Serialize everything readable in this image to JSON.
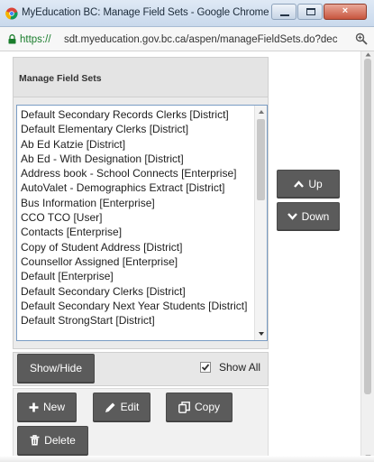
{
  "window": {
    "title": "MyEducation BC: Manage Field Sets - Google Chrome",
    "minimize_label": "",
    "maximize_label": "",
    "close_label": "×"
  },
  "address_bar": {
    "scheme": "https://",
    "url_rest": "sdt.myeducation.gov.bc.ca/aspen/manageFieldSets.do?dec"
  },
  "panel": {
    "title": "Manage Field Sets"
  },
  "field_sets": [
    "Default Secondary Records Clerks [District]",
    "Default Elementary Clerks [District]",
    "Ab Ed Katzie [District]",
    "Ab Ed - With Designation [District]",
    "Address book - School Connects [Enterprise]",
    "AutoValet - Demographics Extract [District]",
    "Bus Information [Enterprise]",
    "CCO TCO [User]",
    "Contacts [Enterprise]",
    "Copy of Student Address [District]",
    "Counsellor Assigned [Enterprise]",
    "Default [Enterprise]",
    "Default Secondary Clerks [District]",
    "Default Secondary Next Year Students [District]",
    "Default StrongStart [District]"
  ],
  "buttons": {
    "up": "Up",
    "down": "Down",
    "show_hide": "Show/Hide",
    "new": "New",
    "edit": "Edit",
    "copy": "Copy",
    "delete": "Delete"
  },
  "show_all": {
    "label": "Show All",
    "checked": true
  },
  "colors": {
    "button_bg": "#5b5b5b",
    "listbox_border": "#7a9cc4",
    "url_scheme": "#1a7d2c"
  }
}
